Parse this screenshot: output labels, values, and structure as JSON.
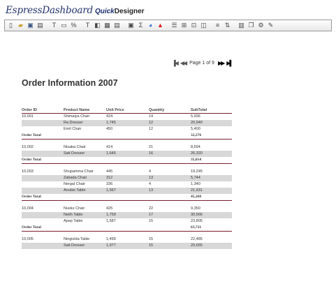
{
  "logo": {
    "brand": "EspressDashboard",
    "product": "Quick",
    "suffix": "Designer"
  },
  "toolbar": {
    "groups": [
      [
        "new-icon",
        "open-icon",
        "save-icon",
        "export-icon"
      ],
      [
        "text-icon",
        "frame-icon",
        "format-icon"
      ],
      [
        "textfield-icon",
        "image-icon",
        "chart-icon",
        "table-icon"
      ],
      [
        "insert-icon",
        "sum-icon",
        "piechart-icon",
        "warning-icon"
      ],
      [
        "align-icon",
        "grid-icon",
        "snap-icon",
        "layer-icon"
      ],
      [
        "list-icon",
        "sort-icon"
      ],
      [
        "columns-icon",
        "copy-icon",
        "settings-icon",
        "tools-icon"
      ]
    ]
  },
  "pager": {
    "label": "Page 1 of 9"
  },
  "report": {
    "title": "Order Information 2007",
    "columns": [
      "Order ID",
      "Product Name",
      "Unit Price",
      "Quantity",
      "SubTotal"
    ],
    "total_label": "Order Total",
    "orders": [
      {
        "id": "10,001",
        "rows": [
          [
            "Shimaiya Chair",
            "424",
            "14",
            "5,936"
          ],
          [
            "Ra Dresser",
            "1,745",
            "12",
            "20,940"
          ],
          [
            "Emil Chair",
            "450",
            "12",
            "5,400"
          ]
        ],
        "total": "32,276"
      },
      {
        "id": "10,002",
        "rows": [
          [
            "Nisaba Chair",
            "414",
            "21",
            "8,694"
          ],
          [
            "Sati Dresser",
            "1,645",
            "16",
            "26,320"
          ]
        ],
        "total": "35,014"
      },
      {
        "id": "10,003",
        "rows": [
          [
            "Shupamma Chair",
            "445",
            "4",
            "19,245"
          ],
          [
            "Zabada Chair",
            "312",
            "13",
            "5,744"
          ],
          [
            "Nergal Chair",
            "336",
            "4",
            "1,340"
          ],
          [
            "Anubis Table",
            "1,567",
            "13",
            "21,931"
          ]
        ],
        "total": "45,260"
      },
      {
        "id": "10,004",
        "rows": [
          [
            "Nusku Chair",
            "425",
            "22",
            "9,350"
          ],
          [
            "Neith Table",
            "1,759",
            "17",
            "30,566"
          ],
          [
            "Apep Table",
            "1,587",
            "15",
            "23,805"
          ]
        ],
        "total": "63,721"
      },
      {
        "id": "10,005",
        "rows": [
          [
            "Ningizida Table",
            "1,499",
            "15",
            "22,485"
          ],
          [
            "Sati Dresser",
            "1,977",
            "15",
            "29,655"
          ]
        ],
        "total": ""
      }
    ]
  }
}
